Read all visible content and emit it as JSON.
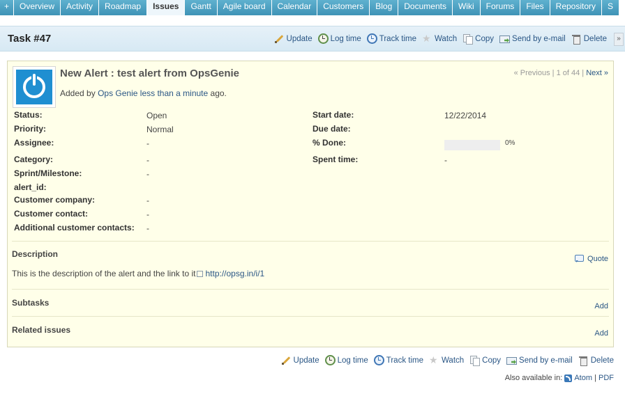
{
  "tabs": [
    {
      "label": "+",
      "active": false
    },
    {
      "label": "Overview",
      "active": false
    },
    {
      "label": "Activity",
      "active": false
    },
    {
      "label": "Roadmap",
      "active": false
    },
    {
      "label": "Issues",
      "active": true
    },
    {
      "label": "Gantt",
      "active": false
    },
    {
      "label": "Agile board",
      "active": false
    },
    {
      "label": "Calendar",
      "active": false
    },
    {
      "label": "Customers",
      "active": false
    },
    {
      "label": "Blog",
      "active": false
    },
    {
      "label": "Documents",
      "active": false
    },
    {
      "label": "Wiki",
      "active": false
    },
    {
      "label": "Forums",
      "active": false
    },
    {
      "label": "Files",
      "active": false
    },
    {
      "label": "Repository",
      "active": false
    },
    {
      "label": "S",
      "active": false
    }
  ],
  "page": {
    "title": "Task #47",
    "expander": "»"
  },
  "actions": {
    "update": "Update",
    "log_time": "Log time",
    "track_time": "Track time",
    "watch": "Watch",
    "copy": "Copy",
    "send_email": "Send by e-mail",
    "delete": "Delete"
  },
  "issue": {
    "subject": "New Alert : test alert from OpsGenie",
    "added_by_prefix": "Added by",
    "author": "Ops Genie",
    "time_ago": "less than a minute",
    "added_suffix": "ago.",
    "nav": {
      "previous": "« Previous",
      "sep1": "|",
      "position": "1 of 44",
      "sep2": "|",
      "next": "Next »"
    },
    "attributes_left": [
      {
        "label": "Status:",
        "value": "Open"
      },
      {
        "label": "Priority:",
        "value": "Normal"
      },
      {
        "label": "Assignee:",
        "value": "-"
      },
      {
        "label": "Category:",
        "value": "-"
      },
      {
        "label": "Sprint/Milestone:",
        "value": "-"
      },
      {
        "label": "alert_id:",
        "value": ""
      },
      {
        "label": "Customer company:",
        "value": "-"
      },
      {
        "label": "Customer contact:",
        "value": "-"
      },
      {
        "label": "Additional customer contacts:",
        "value": "-"
      }
    ],
    "attributes_right": [
      {
        "label": "Start date:",
        "value": "12/22/2014"
      },
      {
        "label": "Due date:",
        "value": ""
      },
      {
        "label": "% Done:",
        "value": "0%"
      },
      {
        "label": "Spent time:",
        "value": "-"
      }
    ],
    "done_ratio": 0,
    "description": {
      "title": "Description",
      "quote": "Quote",
      "text": "This is the description of the alert and the link to it",
      "link": "http://opsg.in/i/1"
    },
    "subtasks": {
      "title": "Subtasks",
      "add": "Add"
    },
    "related": {
      "title": "Related issues",
      "add": "Add"
    }
  },
  "footer": {
    "also_available": "Also available in:",
    "atom": "Atom",
    "sep": "|",
    "pdf": "PDF"
  },
  "colors": {
    "tab_bg": "#4ba0c0",
    "issue_bg": "#ffffe9",
    "link": "#2a5685",
    "avatar_blue": "#1f8fd1"
  }
}
